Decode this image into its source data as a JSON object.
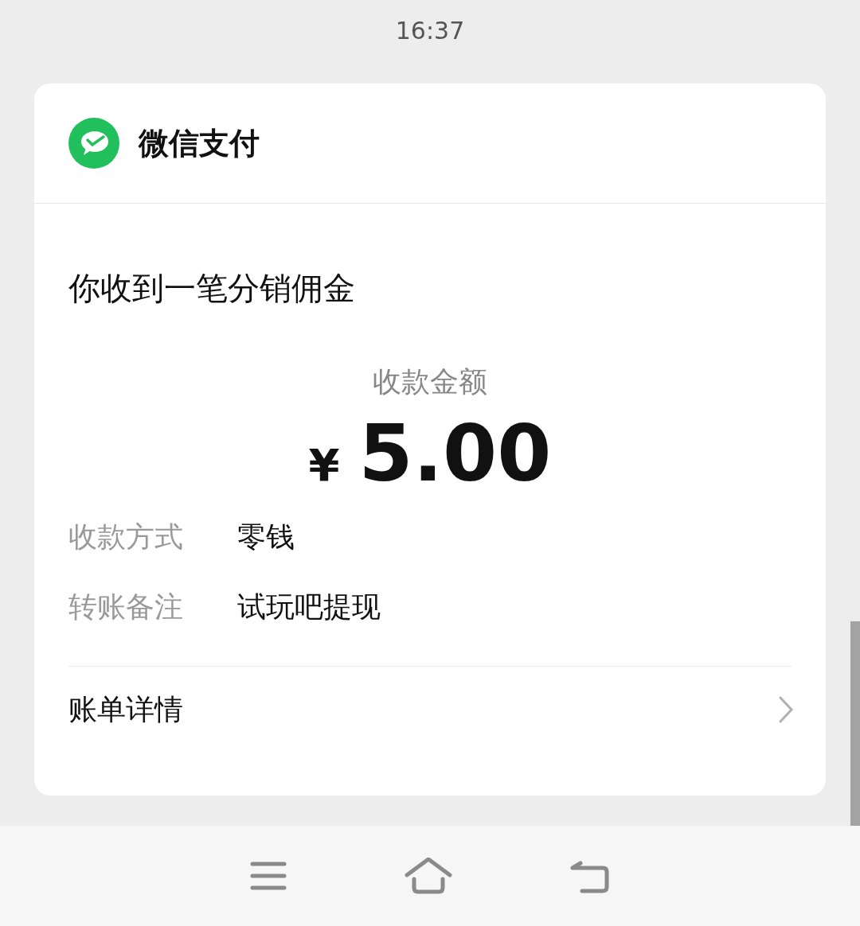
{
  "status_bar": {
    "time": "16:37"
  },
  "card": {
    "brand": "微信支付",
    "title": "你收到一笔分销佣金",
    "amount_label": "收款金额",
    "currency": "¥",
    "amount": "5.00",
    "details": [
      {
        "label": "收款方式",
        "value": "零钱"
      },
      {
        "label": "转账备注",
        "value": "试玩吧提现"
      }
    ],
    "link": "账单详情"
  }
}
